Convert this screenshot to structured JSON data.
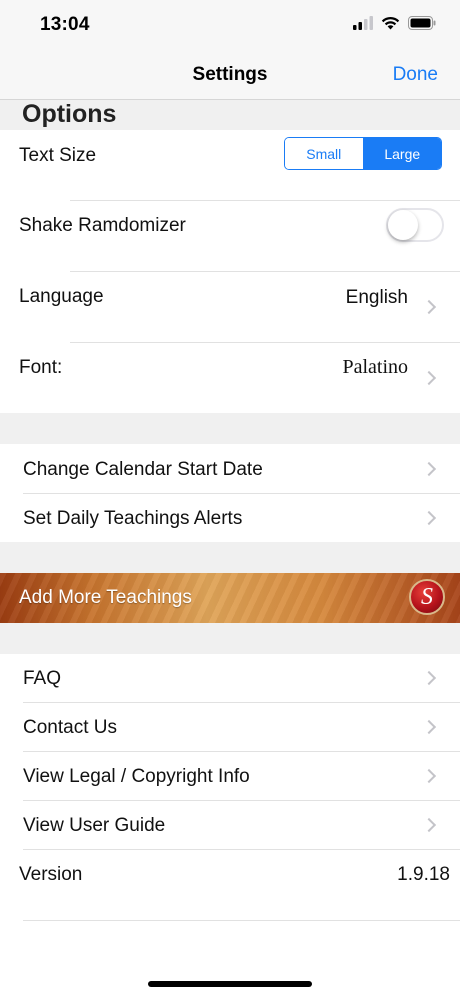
{
  "status_bar": {
    "time": "13:04"
  },
  "nav": {
    "title": "Settings",
    "done_label": "Done"
  },
  "options": {
    "header": "Options",
    "text_size": {
      "label": "Text Size",
      "small_label": "Small",
      "large_label": "Large",
      "selected": "Large"
    },
    "shake": {
      "label": "Shake Ramdomizer",
      "on": false
    },
    "language": {
      "label": "Language",
      "value": "English"
    },
    "font": {
      "label": "Font:",
      "value": "Palatino"
    }
  },
  "calendar": {
    "change_start_date": "Change Calendar Start Date",
    "daily_alerts": "Set Daily Teachings Alerts"
  },
  "banner": {
    "label": "Add More Teachings",
    "logo_letter": "S"
  },
  "info": {
    "faq": "FAQ",
    "contact": "Contact Us",
    "legal": "View Legal / Copyright Info",
    "guide": "View User Guide",
    "version_label": "Version",
    "version_value": "1.9.18"
  },
  "colors": {
    "accent": "#1a7cf5",
    "section_bg": "#f0f0f0"
  }
}
